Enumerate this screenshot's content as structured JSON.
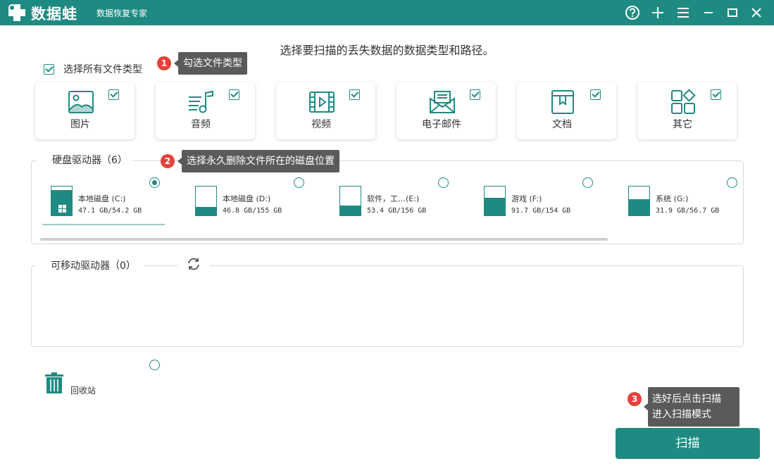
{
  "app": {
    "name": "数据蛙",
    "subtitle": "数据恢复专家",
    "accent_color": "#1f8a82"
  },
  "titlebar": {
    "help_icon": "help-icon",
    "add_icon": "plus-icon",
    "menu_icon": "menu-icon",
    "minimize_icon": "minimize-icon",
    "maximize_icon": "maximize-icon",
    "close_icon": "close-icon"
  },
  "main": {
    "instruction": "选择要扫描的丢失数据的数据类型和路径。",
    "select_all_label": "选择所有文件类型",
    "select_all_checked": true
  },
  "file_types": [
    {
      "label": "图片",
      "icon": "image-icon",
      "checked": true
    },
    {
      "label": "音频",
      "icon": "audio-icon",
      "checked": true
    },
    {
      "label": "视频",
      "icon": "video-icon",
      "checked": true
    },
    {
      "label": "电子邮件",
      "icon": "email-icon",
      "checked": true
    },
    {
      "label": "文档",
      "icon": "document-icon",
      "checked": true
    },
    {
      "label": "其它",
      "icon": "other-icon",
      "checked": true
    }
  ],
  "hard_drives": {
    "title": "硬盘驱动器（6）",
    "drives": [
      {
        "name": "本地磁盘 (C:)",
        "size": "47.1 GB/54.2 GB",
        "used_fraction": 0.87,
        "selected": true,
        "system": true
      },
      {
        "name": "本地磁盘 (D:)",
        "size": "46.8 GB/155 GB",
        "used_fraction": 0.3,
        "selected": false
      },
      {
        "name": "软件，工…(E:)",
        "size": "53.4 GB/156 GB",
        "used_fraction": 0.34,
        "selected": false
      },
      {
        "name": "游戏 (F:)",
        "size": "91.7 GB/154 GB",
        "used_fraction": 0.6,
        "selected": false
      },
      {
        "name": "系统 (G:)",
        "size": "31.9 GB/56.7 GB",
        "used_fraction": 0.56,
        "selected": false
      }
    ]
  },
  "removable_drives": {
    "title": "可移动驱动器（0）",
    "refresh_icon": "refresh-icon"
  },
  "recycle_bin": {
    "label": "回收站",
    "selected": false
  },
  "tips": [
    {
      "number": "1",
      "text": "勾选文件类型"
    },
    {
      "number": "2",
      "text": "选择永久删除文件所在的磁盘位置"
    },
    {
      "number": "3",
      "text_line1": "选好后点击扫描",
      "text_line2": "进入扫描模式"
    }
  ],
  "scan_button": {
    "label": "扫描"
  }
}
